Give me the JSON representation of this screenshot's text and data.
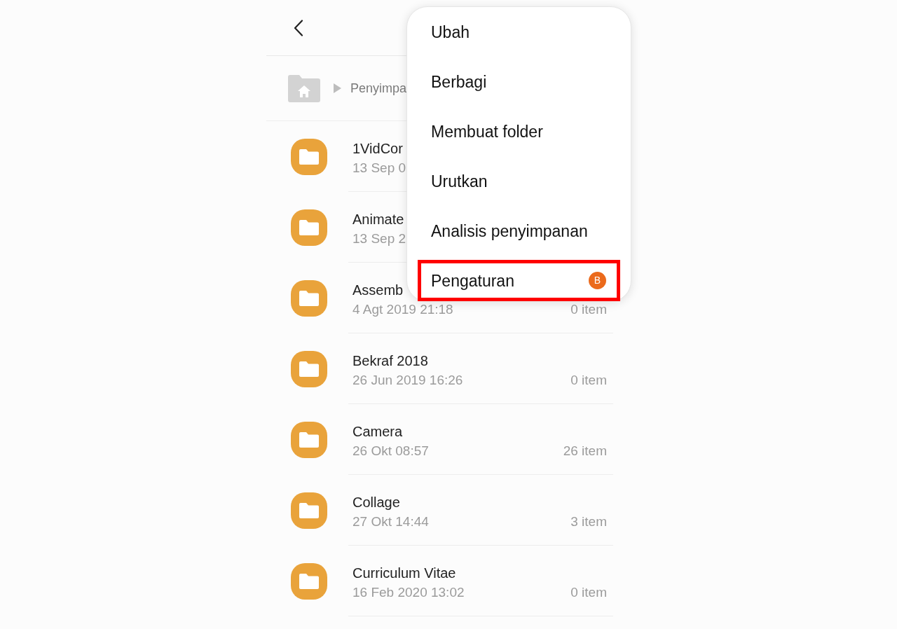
{
  "breadcrumb": [
    {
      "label": "Penyimpa"
    }
  ],
  "folders": [
    {
      "name": "1VidCor",
      "modified": "13 Sep 0"
    },
    {
      "name": "Animate",
      "modified": "13 Sep 2"
    },
    {
      "name": "Assemb",
      "modified": "4 Agt 2019 21:18",
      "count": "0 item"
    },
    {
      "name": "Bekraf 2018",
      "modified": "26 Jun 2019 16:26",
      "count": "0 item"
    },
    {
      "name": "Camera",
      "modified": "26 Okt 08:57",
      "count": "26 item"
    },
    {
      "name": "Collage",
      "modified": "27 Okt 14:44",
      "count": "3 item"
    },
    {
      "name": "Curriculum Vitae",
      "modified": "16 Feb 2020 13:02",
      "count": "0 item"
    }
  ],
  "menu": {
    "items": [
      {
        "label": "Ubah",
        "highlighted": false
      },
      {
        "label": "Berbagi",
        "highlighted": false
      },
      {
        "label": "Membuat folder",
        "highlighted": false
      },
      {
        "label": "Urutkan",
        "highlighted": false
      },
      {
        "label": "Analisis penyimpanan",
        "highlighted": false
      },
      {
        "label": "Pengaturan",
        "highlighted": true,
        "badge": "B"
      }
    ]
  }
}
